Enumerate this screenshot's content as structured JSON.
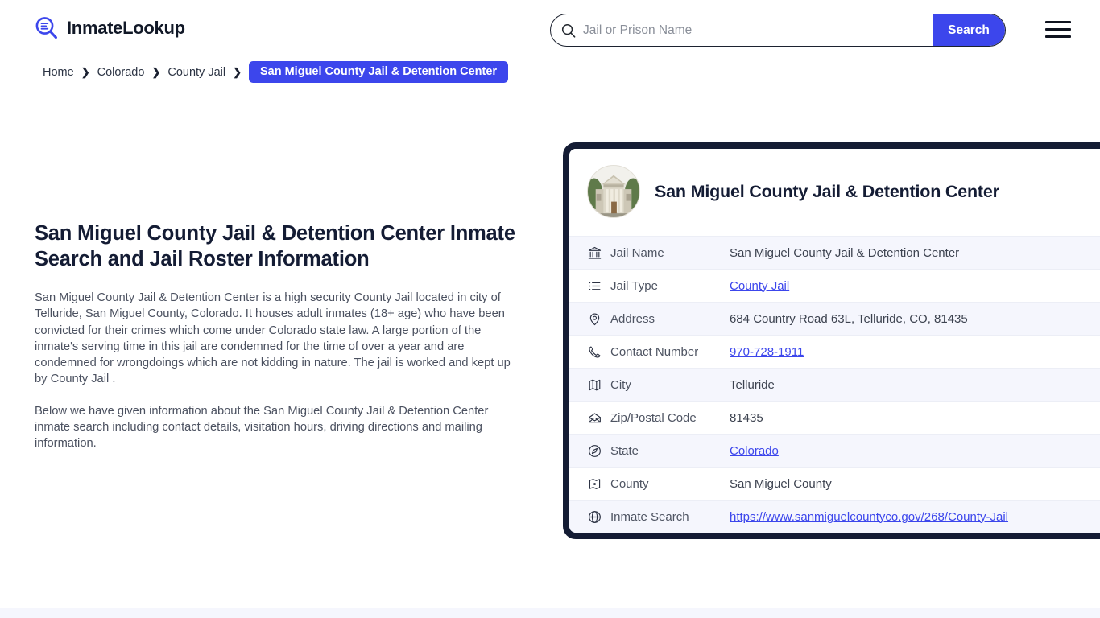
{
  "brand": {
    "name": "InmateLookup",
    "logo_icon": "magnifier-list-icon"
  },
  "search": {
    "placeholder": "Jail or Prison Name",
    "value": "",
    "button_label": "Search",
    "icon": "search-icon"
  },
  "menu": {
    "icon": "hamburger-menu-icon"
  },
  "breadcrumb": {
    "separator": "❯",
    "items": [
      {
        "label": "Home",
        "current": false
      },
      {
        "label": "Colorado",
        "current": false
      },
      {
        "label": "County Jail",
        "current": false
      },
      {
        "label": "San Miguel County Jail & Detention Center",
        "current": true
      }
    ]
  },
  "main": {
    "title": "San Miguel County Jail & Detention Center Inmate Search and Jail Roster Information",
    "paragraphs": [
      "San Miguel County Jail & Detention Center is a high security County Jail located in city of Telluride, San Miguel County, Colorado. It houses adult inmates (18+ age) who have been convicted for their crimes which come under Colorado state law. A large portion of the inmate's serving time in this jail are condemned for the time of over a year and are condemned for wrongdoings which are not kidding in nature. The jail is worked and kept up by County Jail .",
      "Below we have given information about the San Miguel County Jail & Detention Center inmate search including contact details, visitation hours, driving directions and mailing information."
    ]
  },
  "card": {
    "title": "San Miguel County Jail & Detention Center",
    "photo_alt": "courthouse-photo",
    "rows": [
      {
        "icon": "bank-icon",
        "label": "Jail Name",
        "value": "San Miguel County Jail & Detention Center",
        "link": false
      },
      {
        "icon": "list-icon",
        "label": "Jail Type",
        "value": "County Jail",
        "link": true
      },
      {
        "icon": "location-pin-icon",
        "label": "Address",
        "value": "684 Country Road 63L, Telluride, CO, 81435",
        "link": false
      },
      {
        "icon": "phone-icon",
        "label": "Contact Number",
        "value": "970-728-1911",
        "link": true
      },
      {
        "icon": "map-icon",
        "label": "City",
        "value": "Telluride",
        "link": false
      },
      {
        "icon": "envelope-icon",
        "label": "Zip/Postal Code",
        "value": "81435",
        "link": false
      },
      {
        "icon": "compass-icon",
        "label": "State",
        "value": "Colorado",
        "link": true
      },
      {
        "icon": "county-map-icon",
        "label": "County",
        "value": "San Miguel County",
        "link": false
      },
      {
        "icon": "globe-icon",
        "label": "Inmate Search",
        "value": "https://www.sanmiguelcountyco.gov/268/County-Jail",
        "link": true
      }
    ]
  },
  "colors": {
    "accent": "#3c46ec",
    "dark": "#141c34",
    "row_alt": "#f5f6fd",
    "body_text": "#4b5160"
  }
}
